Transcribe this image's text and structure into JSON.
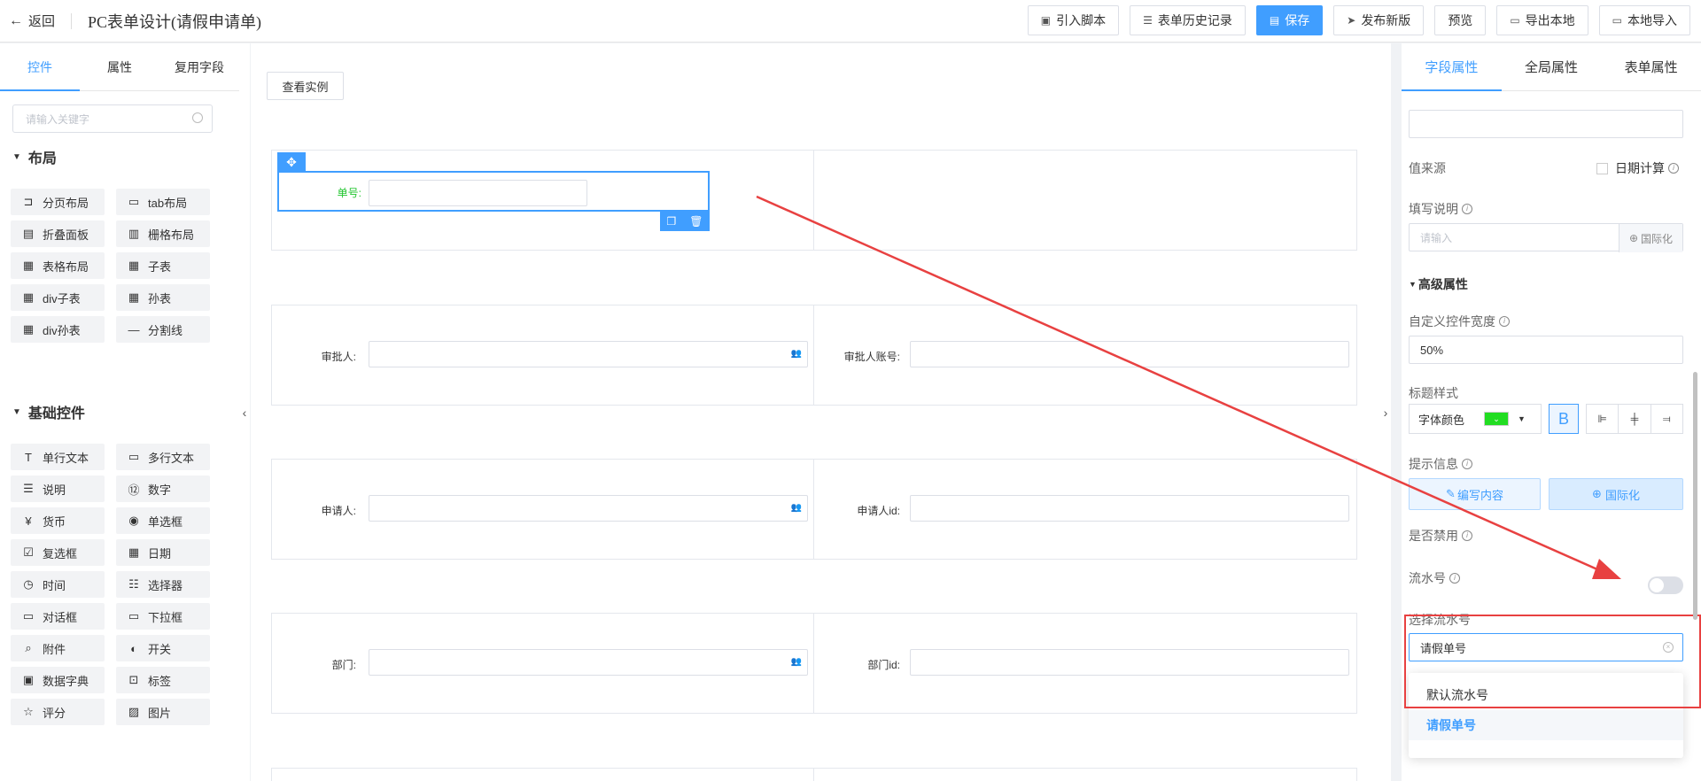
{
  "topbar": {
    "back_label": "返回",
    "title": "PC表单设计(请假申请单)",
    "buttons": {
      "import_script": "引入脚本",
      "history": "表单历史记录",
      "save": "保存",
      "publish": "发布新版",
      "preview": "预览",
      "export": "导出本地",
      "local_import": "本地导入"
    }
  },
  "left": {
    "tabs": [
      "控件",
      "属性",
      "复用字段"
    ],
    "search_placeholder": "请输入关键字",
    "layout_section": "布局",
    "layout_items": [
      "分页布局",
      "tab布局",
      "折叠面板",
      "栅格布局",
      "表格布局",
      "子表",
      "div子表",
      "孙表",
      "div孙表",
      "分割线"
    ],
    "basic_section": "基础控件",
    "basic_items": [
      "单行文本",
      "多行文本",
      "说明",
      "数字",
      "货币",
      "单选框",
      "复选框",
      "日期",
      "时间",
      "选择器",
      "对话框",
      "下拉框",
      "附件",
      "开关",
      "数据字典",
      "标签",
      "评分",
      "图片"
    ]
  },
  "canvas": {
    "example_button": "查看实例",
    "fields": {
      "order_no": "单号:",
      "approver": "审批人:",
      "approver_account": "审批人账号:",
      "applicant": "申请人:",
      "applicant_id": "申请人id:",
      "dept": "部门:",
      "dept_id": "部门id:"
    },
    "highlight_color": "#22c52f"
  },
  "right": {
    "tabs": [
      "字段属性",
      "全局属性",
      "表单属性"
    ],
    "value_source_label": "值来源",
    "date_calc_label": "日期计算",
    "fill_desc_label": "填写说明",
    "fill_desc_placeholder": "请输入",
    "intl_label": "国际化",
    "advanced_label": "高级属性",
    "custom_width_label": "自定义控件宽度",
    "custom_width_value": "50%",
    "title_style_label": "标题样式",
    "font_color_label": "字体颜色",
    "font_color": "#22dd22",
    "bold_label": "B",
    "hint_label": "提示信息",
    "edit_content_label": "编写内容",
    "intl_button_label": "国际化",
    "disabled_label": "是否禁用",
    "disabled_on": false,
    "serial_label": "流水号",
    "serial_on": true,
    "select_serial_label": "选择流水号",
    "select_serial_value": "请假单号",
    "options": [
      "默认流水号",
      "请假单号"
    ],
    "selected_option": "请假单号"
  }
}
